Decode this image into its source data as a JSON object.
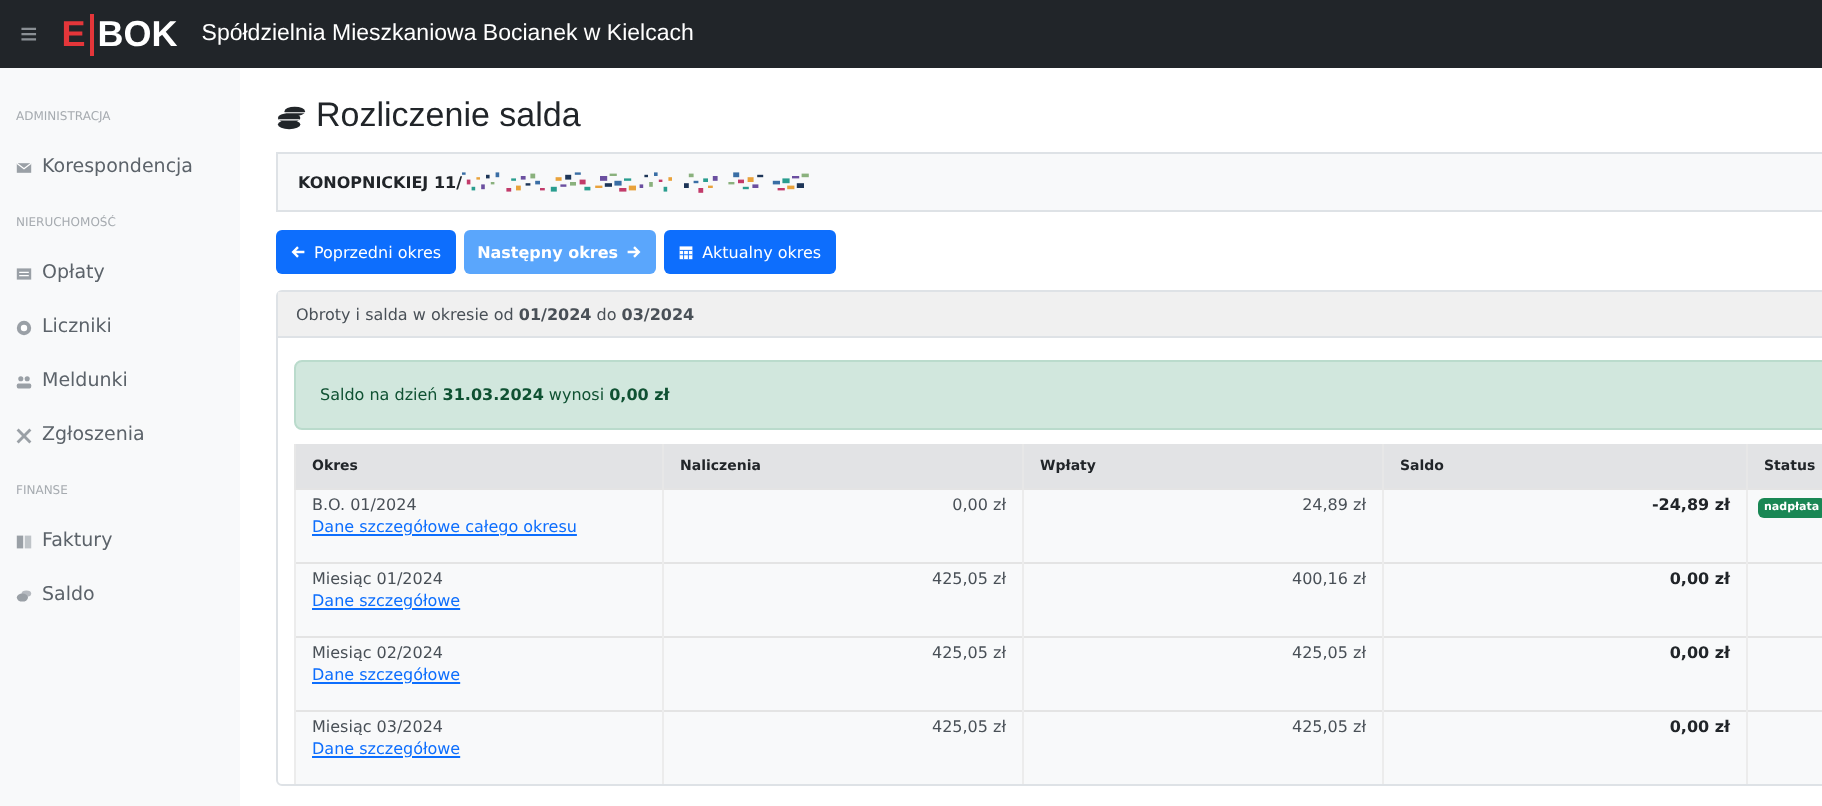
{
  "header": {
    "menu_icon": "≡",
    "logo_left": "E",
    "logo_right": "BOK",
    "title": "Spółdzielnia Mieszkaniowa Bocianek w Kielcach"
  },
  "sidebar": {
    "items": [
      {
        "kind": "section",
        "label": "ADMINISTRACJA"
      },
      {
        "kind": "link",
        "label": "Korespondencja"
      },
      {
        "kind": "section",
        "label": "NIERUCHOMOŚĆ"
      },
      {
        "kind": "link",
        "label": "Opłaty"
      },
      {
        "kind": "link",
        "label": "Liczniki"
      },
      {
        "kind": "link",
        "label": "Meldunki"
      },
      {
        "kind": "link",
        "label": "Zgłoszenia"
      },
      {
        "kind": "section",
        "label": "FINANSE"
      },
      {
        "kind": "link",
        "label": "Faktury"
      },
      {
        "kind": "link",
        "label": "Saldo"
      }
    ]
  },
  "page": {
    "title": "Rozliczenie salda",
    "address": "KONOPNICKIEJ 11/"
  },
  "buttons": [
    {
      "label": "Poprzedni okres",
      "disabled": false
    },
    {
      "label": "Następny okres",
      "disabled": true
    },
    {
      "label": "Aktualny okres",
      "disabled": false
    }
  ],
  "period_header": "Obroty i salda w okresie od **01/2024** do **03/2024**",
  "balance_alert": "Saldo na dzień **31.03.2024** wynosi **0,00 zł**",
  "table": {
    "columns": [
      "Okres",
      "Naliczenia",
      "Wpłaty",
      "Saldo",
      "Status"
    ],
    "rows": [
      {
        "period": "B.O. 01/2024",
        "link": "Dane szczegółowe całego okresu",
        "charges": "0,00 zł",
        "payments": "24,89 zł",
        "balance": "-24,89 zł",
        "status": "nadpłata",
        "color": "#198754"
      },
      {
        "period": "Miesiąc 01/2024",
        "link": "Dane szczegółowe",
        "charges": "425,05 zł",
        "payments": "400,16 zł",
        "balance": "0,00 zł"
      },
      {
        "period": "Miesiąc 02/2024",
        "link": "Dane szczegółowe",
        "charges": "425,05 zł",
        "payments": "425,05 zł",
        "balance": "0,00 zł"
      },
      {
        "period": "Miesiąc 03/2024",
        "link": "Dane szczegółowe",
        "charges": "425,05 zł",
        "payments": "425,05 zł",
        "balance": "0,00 zł"
      }
    ]
  }
}
